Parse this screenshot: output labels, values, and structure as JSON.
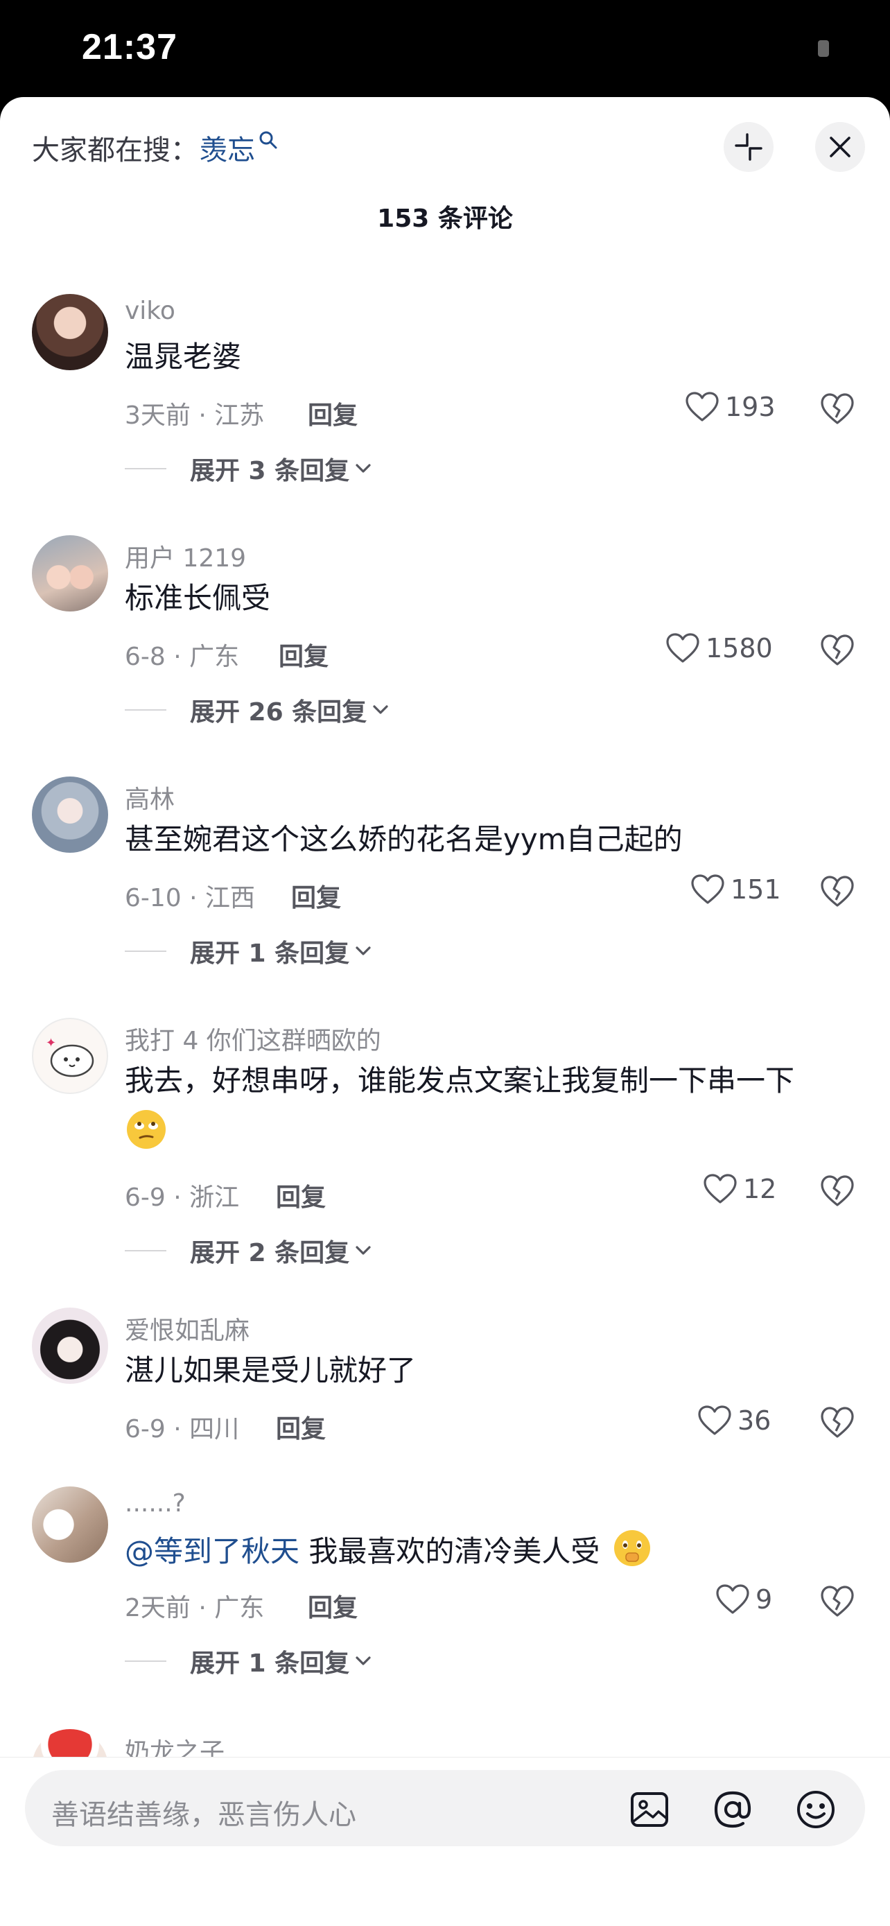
{
  "status_bar": {
    "time": "21:37"
  },
  "header": {
    "search_prefix": "大家都在搜：",
    "search_term": "羡忘",
    "comment_count": "153 条评论"
  },
  "comments": [
    {
      "username": "viko",
      "text": "温晁老婆",
      "meta": "3天前 · 江苏",
      "reply": "回复",
      "likes": "193",
      "expand": "展开 3 条回复"
    },
    {
      "username": "用户 1219",
      "text": "标准长佩受",
      "meta": "6-8 · 广东",
      "reply": "回复",
      "likes": "1580",
      "expand": "展开 26 条回复"
    },
    {
      "username": "高林",
      "text": "甚至婉君这个这么娇的花名是yym自己起的",
      "meta": "6-10 · 江西",
      "reply": "回复",
      "likes": "151",
      "expand": "展开 1 条回复"
    },
    {
      "username": "我打 4 你们这群晒欧的",
      "text": "我去，好想串呀，谁能发点文案让我复制一下串一下",
      "meta": "6-9 · 浙江",
      "reply": "回复",
      "likes": "12",
      "expand": "展开 2 条回复"
    },
    {
      "username": "爱恨如乱麻",
      "text": "湛儿如果是受儿就好了",
      "meta": "6-9 · 四川",
      "reply": "回复",
      "likes": "36"
    },
    {
      "username": "......?",
      "mention": "@等到了秋天",
      "text": " 我最喜欢的清冷美人受",
      "meta": "2天前 · 广东",
      "reply": "回复",
      "likes": "9",
      "expand": "展开 1 条回复"
    },
    {
      "username": "奶龙之子"
    }
  ],
  "input": {
    "placeholder": "善语结善缘，恶言伤人心"
  },
  "icons": {
    "search_hint": "magnifier-icon",
    "collapse": "collapse-arrows-icon",
    "close": "close-icon",
    "like": "heart-icon",
    "dislike": "broken-heart-icon",
    "chevron": "chevron-down-icon",
    "image": "image-icon",
    "mention": "at-icon",
    "emoji": "emoji-icon"
  },
  "colors": {
    "link": "#1f4e8f",
    "text": "#161823",
    "secondary": "#8a8b91"
  }
}
